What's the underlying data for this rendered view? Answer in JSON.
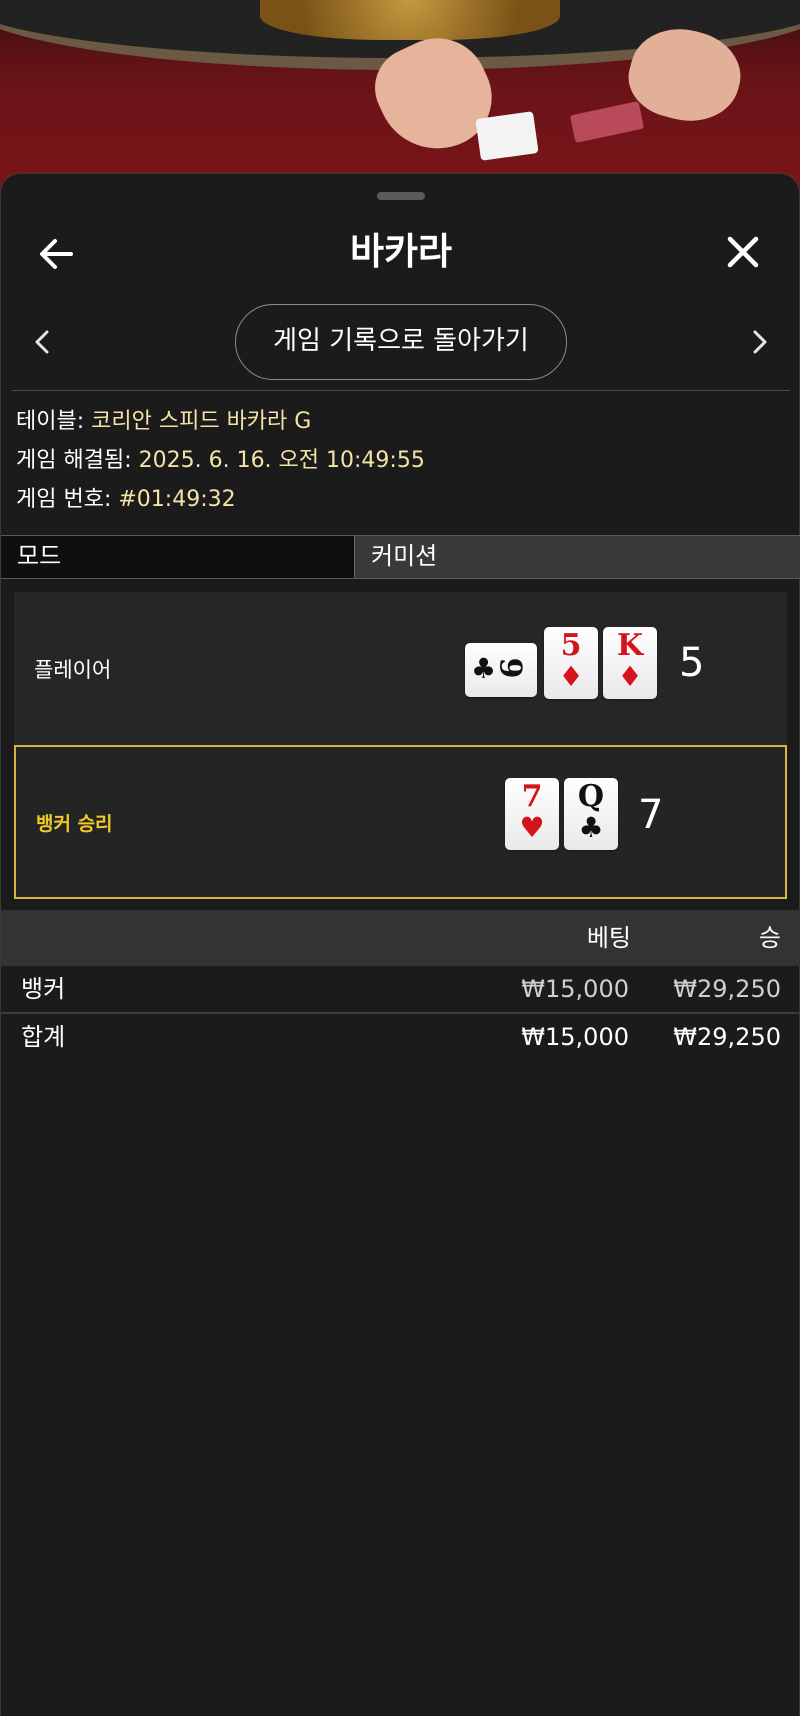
{
  "header": {
    "title": "바카라"
  },
  "nav": {
    "back_to_history_label": "게임 기록으로 돌아가기"
  },
  "info": {
    "table_label": "테이블:",
    "table_value": "코리안 스피드 바카라 G",
    "resolved_label": "게임 해결됨:",
    "resolved_value": "2025. 6. 16. 오전 10:49:55",
    "game_no_label": "게임 번호:",
    "game_no_value": "#01:49:32"
  },
  "tabs": {
    "mode": "모드",
    "commission": "커미션"
  },
  "player": {
    "label": "플레이어",
    "score": "5",
    "cards": [
      {
        "rank": "9",
        "suit": "♣",
        "color": "black",
        "orientation": "sideways"
      },
      {
        "rank": "5",
        "suit": "♦",
        "color": "red"
      },
      {
        "rank": "K",
        "suit": "♦",
        "color": "red"
      }
    ]
  },
  "banker": {
    "label": "뱅커 승리",
    "score": "7",
    "cards": [
      {
        "rank": "7",
        "suit": "♥",
        "color": "red"
      },
      {
        "rank": "Q",
        "suit": "♣",
        "color": "black"
      }
    ]
  },
  "bets": {
    "col_bet": "베팅",
    "col_win": "승",
    "rows": [
      {
        "name": "뱅커",
        "bet": "₩15,000",
        "win": "₩29,250"
      }
    ],
    "total": {
      "name": "합계",
      "bet": "₩15,000",
      "win": "₩29,250"
    }
  },
  "colors": {
    "winner_accent": "#f0c929",
    "info_value": "#f4e3a6",
    "card_red": "#d4141c"
  }
}
